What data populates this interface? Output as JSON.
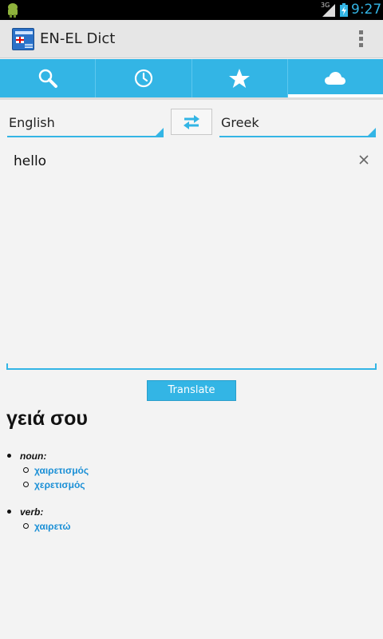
{
  "status_bar": {
    "network": "3G",
    "time": "9:27"
  },
  "action_bar": {
    "title": "EN-EL Dict"
  },
  "tabs": [
    {
      "icon": "search-icon",
      "active": false
    },
    {
      "icon": "history-icon",
      "active": false
    },
    {
      "icon": "star-icon",
      "active": false
    },
    {
      "icon": "cloud-icon",
      "active": true
    }
  ],
  "languages": {
    "from": "English",
    "to": "Greek"
  },
  "input": {
    "value": "hello"
  },
  "translate_button": "Translate",
  "result": {
    "headword": "γειά σου",
    "senses": [
      {
        "pos": "noun:",
        "translations": [
          "χαιρετισμός",
          "χερετισμός"
        ]
      },
      {
        "pos": "verb:",
        "translations": [
          "χαιρετώ"
        ]
      }
    ]
  },
  "colors": {
    "accent": "#33b5e5",
    "link": "#1a8fd6"
  }
}
